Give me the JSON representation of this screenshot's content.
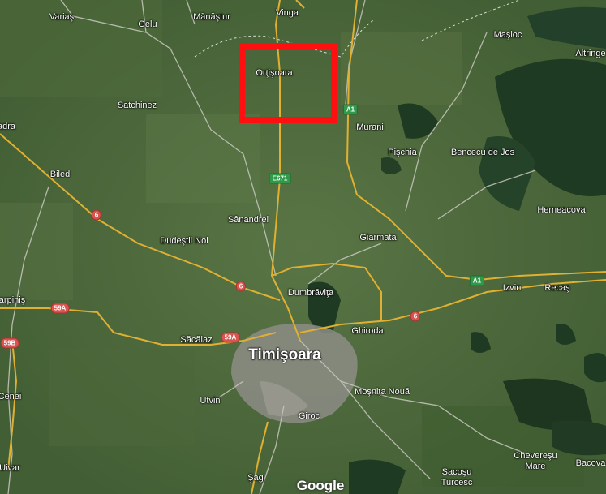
{
  "labels": {
    "varias": "Variaş",
    "gelu": "Gelu",
    "manastur": "Mănăştur",
    "vinga": "Vinga",
    "masloc": "Maşloc",
    "altringen": "Altringe",
    "ortisoara": "Orţişoara",
    "satchinez": "Satchinez",
    "murani": "Murani",
    "adra": "adra",
    "pischia": "Pişchia",
    "bencecu": "Bencecu de Jos",
    "biled": "Biled",
    "herneacova": "Herneacova",
    "sanandrei": "Sânandrei",
    "giarmata": "Giarmata",
    "dudestii_noi": "Dudeştii Noi",
    "izvin": "Izvin",
    "recas": "Recaş",
    "dumbravita": "Dumbrăviţa",
    "carpinis": "arpiniş",
    "ghiroda": "Ghiroda",
    "sacalaz": "Săcălaz",
    "timisoara": "Timişoara",
    "mosnita": "Moşniţa Nouă",
    "cenei": "Cenei",
    "utvin": "Utvin",
    "giroc": "Giroc",
    "cheveresu": "Chevereşu",
    "cheveresu_2": "Mare",
    "bacova": "Bacova",
    "uivar": "Uivar",
    "sag": "Şag",
    "sacosu": "Sacoşu",
    "sacosu_2": "Turcesc"
  },
  "shields": {
    "a1_north": "A1",
    "a1_east": "A1",
    "e671": "E671",
    "r6_west": "6",
    "r6_center": "6",
    "r6_east": "6",
    "r59a_west": "59A",
    "r59a_center": "59A",
    "r59b": "59B"
  },
  "attribution": {
    "logo": "Google"
  },
  "highlight": {
    "color": "#ff1010",
    "target": "Orţişoara"
  },
  "colors": {
    "terrain": "#4a6a3a",
    "forest": "#1f3a22",
    "urban": "#8d8d86",
    "road_major": "#e0b033",
    "road_minor": "#c9c9c0"
  }
}
